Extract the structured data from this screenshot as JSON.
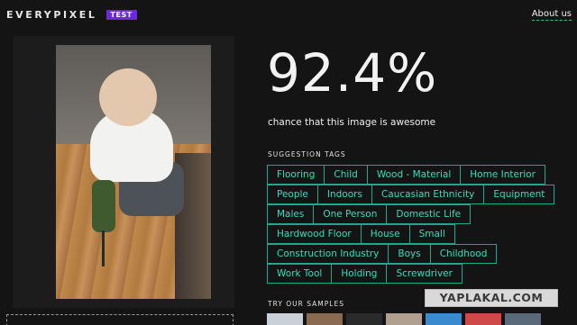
{
  "header": {
    "logo_text": "EVERYPIXEL",
    "badge": "TEST",
    "about_link": "About us"
  },
  "result": {
    "percent": "92.4%",
    "caption": "chance that this image is awesome"
  },
  "suggestions": {
    "label": "SUGGESTION TAGS",
    "rows": [
      [
        "Flooring",
        "Child",
        "Wood - Material",
        "Home Interior"
      ],
      [
        "People",
        "Indoors",
        "Caucasian Ethnicity",
        "Equipment"
      ],
      [
        "Males",
        "One Person",
        "Domestic Life"
      ],
      [
        "Hardwood Floor",
        "House",
        "Small"
      ],
      [
        "Construction Industry",
        "Boys",
        "Childhood"
      ],
      [
        "Work Tool",
        "Holding",
        "Screwdriver"
      ]
    ]
  },
  "samples": {
    "label": "TRY OUR SAMPLES",
    "thumb_colors": [
      "#c8d0d8",
      "#8a6a50",
      "#2a2a2a",
      "#b0a090",
      "#3a8ad0",
      "#d04848",
      "#5a6a7a"
    ]
  },
  "watermark": "YAPLAKAL.COM",
  "colors": {
    "background": "#141414",
    "accent_teal": "#2ee0bd",
    "badge_purple": "#6b2ad8"
  }
}
